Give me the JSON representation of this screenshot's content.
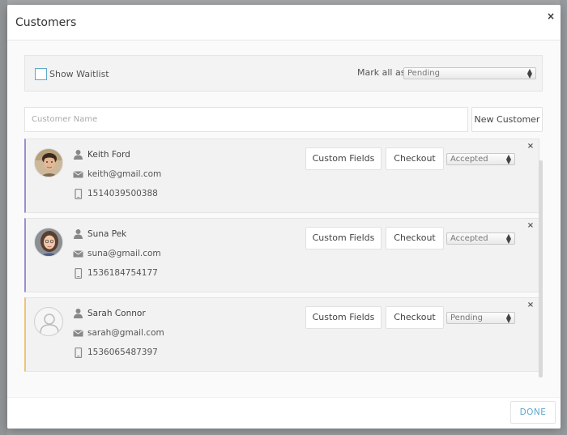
{
  "modal": {
    "title": "Customers",
    "close_label": "×"
  },
  "waitlist": {
    "show_waitlist_label": "Show Waitlist",
    "checked": false,
    "mark_all_label": "Mark all as:",
    "mark_all_value": "Pending"
  },
  "search": {
    "placeholder": "Customer Name",
    "new_customer_label": "New Customer"
  },
  "buttons": {
    "custom_fields": "Custom Fields",
    "checkout": "Checkout",
    "remove": "×",
    "done": "DONE"
  },
  "customers": [
    {
      "name": "Keith Ford",
      "email": "keith@gmail.com",
      "phone": "1514039500388",
      "status": "Accepted",
      "avatar": "photo-man"
    },
    {
      "name": "Suna Pek",
      "email": "suna@gmail.com",
      "phone": "1536184754177",
      "status": "Accepted",
      "avatar": "photo-woman"
    },
    {
      "name": "Sarah Connor",
      "email": "sarah@gmail.com",
      "phone": "1536065487397",
      "status": "Pending",
      "avatar": "placeholder-user"
    }
  ],
  "icons": {
    "user": "user-icon",
    "email": "envelope-icon",
    "phone": "phone-icon",
    "select_arrow": "up-down-arrow-icon"
  },
  "colors": {
    "accepted_border": "#9b8fd3",
    "pending_border": "#f0c276",
    "accent": "#5fa8c9"
  }
}
